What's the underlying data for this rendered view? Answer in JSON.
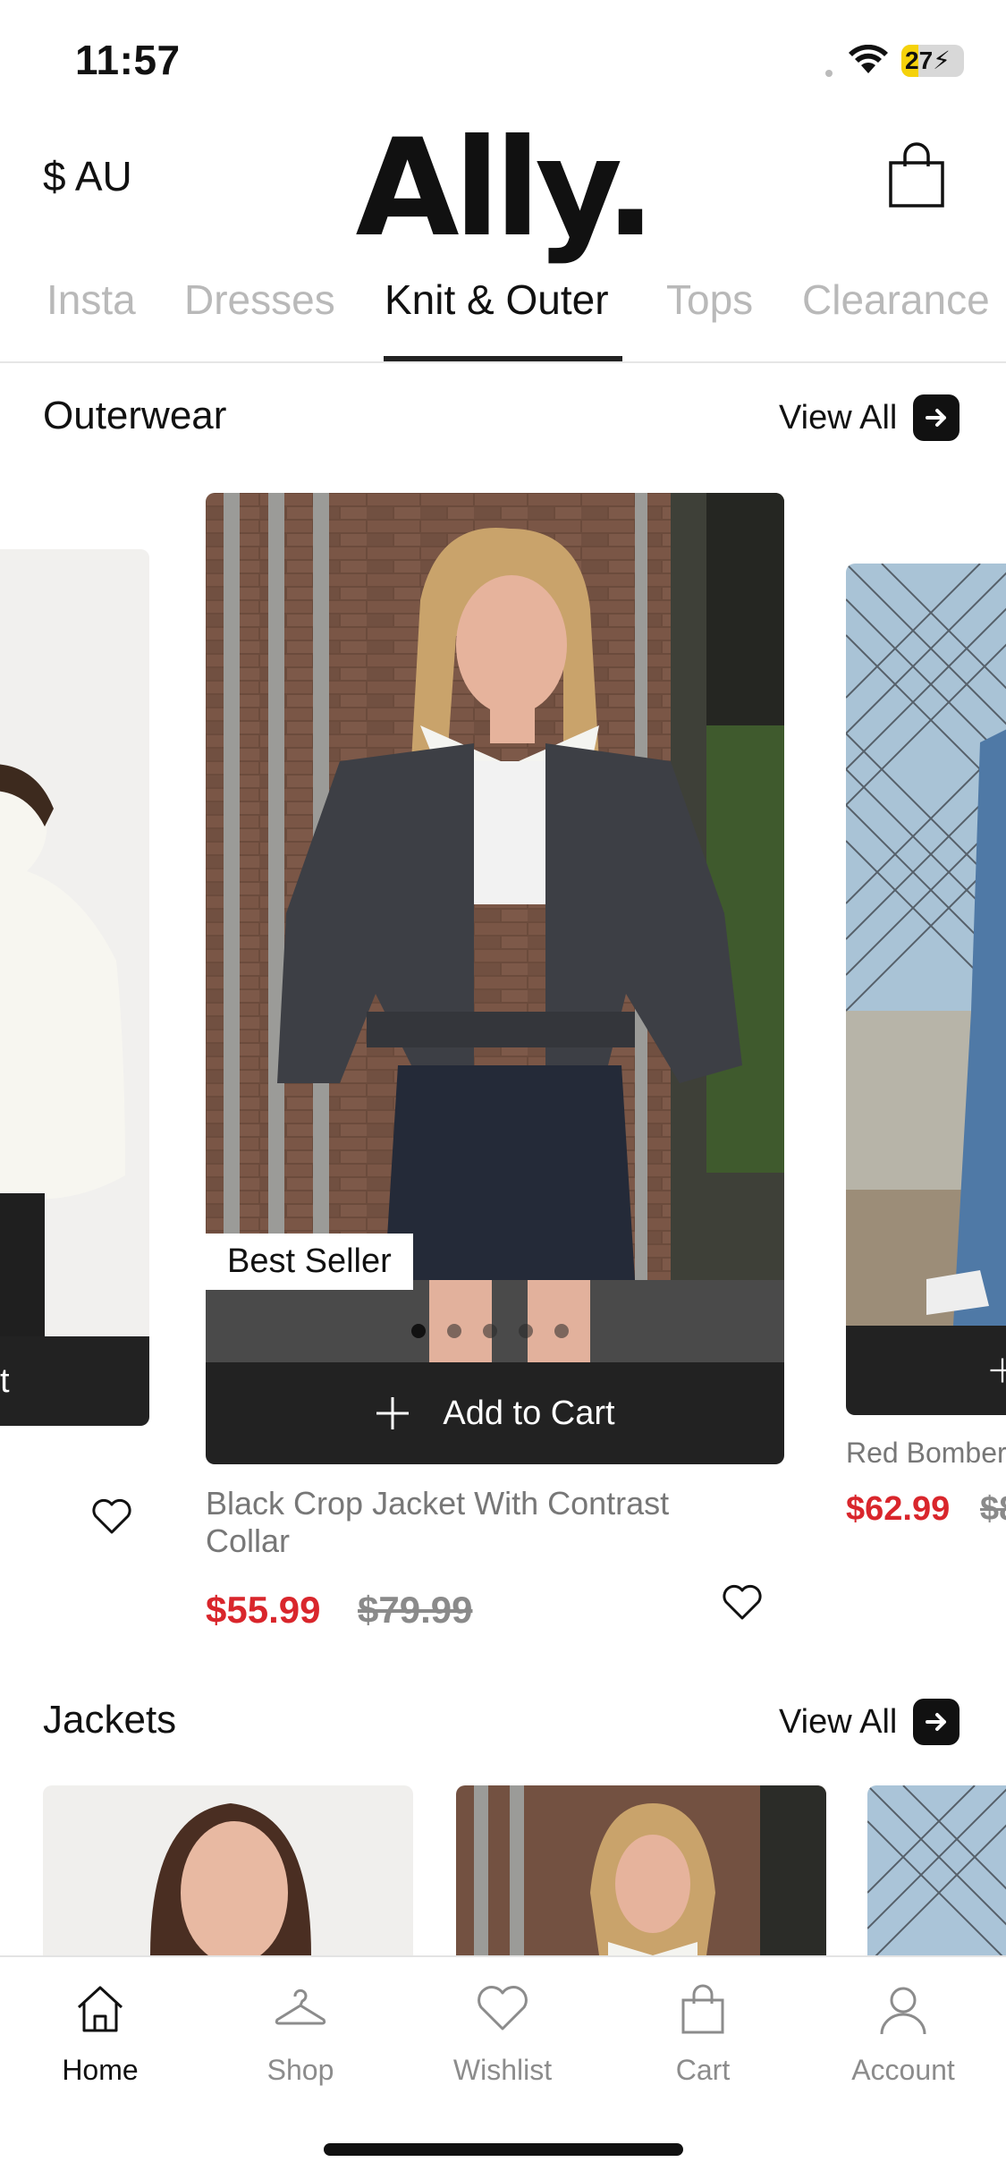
{
  "status_bar": {
    "time": "11:57",
    "battery": "27",
    "battery_level": 0.27
  },
  "header": {
    "currency": "$ AU",
    "logo": "Ally."
  },
  "tabs": [
    {
      "label": "Insta",
      "active": false
    },
    {
      "label": "Dresses",
      "active": false
    },
    {
      "label": "Knit & Outer",
      "active": true
    },
    {
      "label": "Tops",
      "active": false
    },
    {
      "label": "Clearance",
      "active": false
    }
  ],
  "sections": {
    "outerwear": {
      "title": "Outerwear",
      "view_all": "View All"
    },
    "jackets": {
      "title": "Jackets",
      "view_all": "View All"
    }
  },
  "outerwear_products": {
    "left": {
      "add_label": "t"
    },
    "center": {
      "badge": "Best Seller",
      "add_label": "Add to Cart",
      "name": "Black Crop Jacket With Contrast Collar",
      "price": "$55.99",
      "old_price": "$79.99",
      "image_dots": 5,
      "active_dot": 0
    },
    "right": {
      "name": "Red Bomber",
      "price": "$62.99",
      "old_price": "$8"
    }
  },
  "bottom_nav": [
    {
      "label": "Home",
      "icon": "home-icon",
      "active": true
    },
    {
      "label": "Shop",
      "icon": "hanger-icon",
      "active": false
    },
    {
      "label": "Wishlist",
      "icon": "heart-icon",
      "active": false
    },
    {
      "label": "Cart",
      "icon": "bag-icon",
      "active": false
    },
    {
      "label": "Account",
      "icon": "user-icon",
      "active": false
    }
  ],
  "colors": {
    "sale_price": "#d9262c",
    "accent_dark": "#222222",
    "battery": "#f5d20b"
  }
}
